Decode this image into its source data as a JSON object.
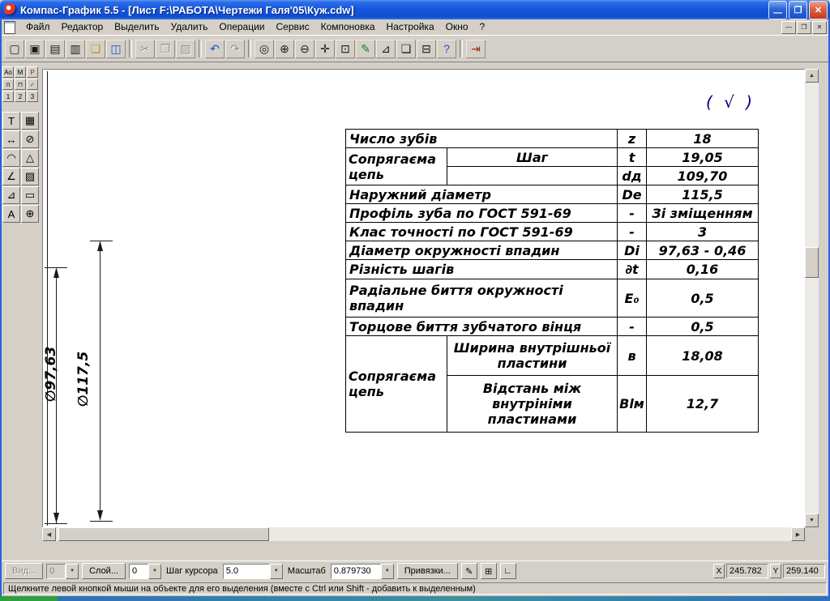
{
  "colors": {
    "titlebar_blue": "#1557DE",
    "close_button_red": "#DE6547",
    "chrome_gray": "#D4D0C8",
    "canvas_white": "#FFFFFF",
    "accent_blue": "#1B4FD8",
    "taskbar_teal": "#3E8F9E"
  },
  "window": {
    "title": "Компас-График 5.5 - [Лист F:\\РАБОТА\\Чертежи Галя'05\\Куж.cdw]",
    "controls": {
      "minimize": "—",
      "restore": "❐",
      "close": "✕"
    }
  },
  "menu": {
    "items": [
      "Файл",
      "Редактор",
      "Выделить",
      "Удалить",
      "Операции",
      "Сервис",
      "Компоновка",
      "Настройка",
      "Окно",
      "?"
    ],
    "mdi": {
      "minimize": "—",
      "restore": "❐",
      "close": "✕"
    }
  },
  "toolbar": {
    "buttons": [
      {
        "name": "new-document",
        "glyph": "▢"
      },
      {
        "name": "new-fragment",
        "glyph": "▣"
      },
      {
        "name": "open-document",
        "glyph": "▤"
      },
      {
        "name": "document-manager",
        "glyph": "▥"
      },
      {
        "name": "open-folder",
        "glyph": "❏"
      },
      {
        "name": "save",
        "glyph": "◫"
      },
      {
        "name": "cut",
        "glyph": "✂"
      },
      {
        "name": "copy",
        "glyph": "❐"
      },
      {
        "name": "paste",
        "glyph": "▨"
      },
      {
        "name": "undo",
        "glyph": "↶"
      },
      {
        "name": "redo",
        "glyph": "↷"
      },
      {
        "name": "zoom",
        "glyph": "◎"
      },
      {
        "name": "zoom-in",
        "glyph": "⊕"
      },
      {
        "name": "zoom-out",
        "glyph": "⊖"
      },
      {
        "name": "pan",
        "glyph": "✛"
      },
      {
        "name": "zoom-area",
        "glyph": "⊡"
      },
      {
        "name": "rebuild",
        "glyph": "✎"
      },
      {
        "name": "measure",
        "glyph": "⊿"
      },
      {
        "name": "print-preview",
        "glyph": "❏"
      },
      {
        "name": "print",
        "glyph": "⊟"
      },
      {
        "name": "context-help",
        "glyph": "?"
      },
      {
        "name": "end-session",
        "glyph": "⇥"
      }
    ]
  },
  "left_toolbar": {
    "top_buttons": [
      "Ао",
      "М",
      "Р",
      "п",
      "⊓",
      "✓"
    ],
    "pages": [
      "1",
      "2",
      "3"
    ],
    "palette": [
      {
        "name": "text-tool",
        "glyph": "T"
      },
      {
        "name": "table-tool",
        "glyph": "▦"
      },
      {
        "name": "linear-dimension-tool",
        "glyph": "↔"
      },
      {
        "name": "diameter-dimension-tool",
        "glyph": "⊘"
      },
      {
        "name": "arc-tool",
        "glyph": "◠"
      },
      {
        "name": "triangle-tool",
        "glyph": "△"
      },
      {
        "name": "angle-dimension-tool",
        "glyph": "∠"
      },
      {
        "name": "hatch-tool",
        "glyph": "▨"
      },
      {
        "name": "leader-tool",
        "glyph": "⊿"
      },
      {
        "name": "rectangle-tool",
        "glyph": "▭"
      },
      {
        "name": "text-align-tool",
        "glyph": "A"
      },
      {
        "name": "centerline-tool",
        "glyph": "⊕"
      }
    ]
  },
  "canvas": {
    "roughness_mark": "( √ )",
    "dimensions": {
      "d1": "∅117,5",
      "d2": "∅97,63"
    },
    "table": {
      "rows": [
        {
          "name": "Число зубів",
          "sym": "z",
          "val": "18"
        },
        {
          "group": "Сопрягаєма\nцепь",
          "sub": "Шаг",
          "sym": "t",
          "val": "19,05"
        },
        {
          "sub": "",
          "sym": "dд",
          "val": "109,70"
        },
        {
          "name": "Наружний діаметр",
          "sym": "De",
          "val": "115,5"
        },
        {
          "name": "Профіль зуба по ГОСТ 591-69",
          "sym": "-",
          "val": "Зі зміщенням"
        },
        {
          "name": "Клас точності по ГОСТ 591-69",
          "sym": "-",
          "val": "3"
        },
        {
          "name": "Діаметр окружності впадин",
          "sym": "Di",
          "val": "97,63 - 0,46"
        },
        {
          "name": "Різність шагів",
          "sym": "∂t",
          "val": "0,16"
        },
        {
          "name": "Радіальне биття окружності\nвпадин",
          "sym": "E₀",
          "val": "0,5"
        },
        {
          "name": "Торцове биття зубчатого вінця",
          "sym": "-",
          "val": "0,5"
        },
        {
          "group": "Сопрягаєма\nцепь",
          "sub": "Ширина внутрішньої\nпластини",
          "sym": "в",
          "val": "18,08"
        },
        {
          "sub": "Відстань між\nвнутрініми\nпластинами",
          "sym": "Вlм",
          "val": "12,7"
        }
      ]
    }
  },
  "scrollbars": {
    "up": "▲",
    "down": "▼",
    "left": "◀",
    "right": "▶"
  },
  "bottom_bar": {
    "view_button": "Вид...",
    "view_value": "0",
    "layer_button": "Слой...",
    "layer_value": "0",
    "cursor_step_label": "Шаг курсора",
    "cursor_step_value": "5.0",
    "scale_label": "Масштаб",
    "scale_value": "0.879730",
    "snaps_button": "Привязки...",
    "tools": [
      {
        "name": "snap-settings",
        "glyph": "✎"
      },
      {
        "name": "grid-toggle",
        "glyph": "⊞"
      },
      {
        "name": "local-cs",
        "glyph": "∟"
      }
    ],
    "dropdown_glyph": "▼",
    "x_label": "X",
    "x_value": "245.782",
    "y_label": "Y",
    "y_value": "259.140"
  },
  "status_bar": {
    "text": "Щелкните левой кнопкой мыши на объекте для его выделения (вместе с Ctrl или Shift - добавить к выделенным)"
  }
}
